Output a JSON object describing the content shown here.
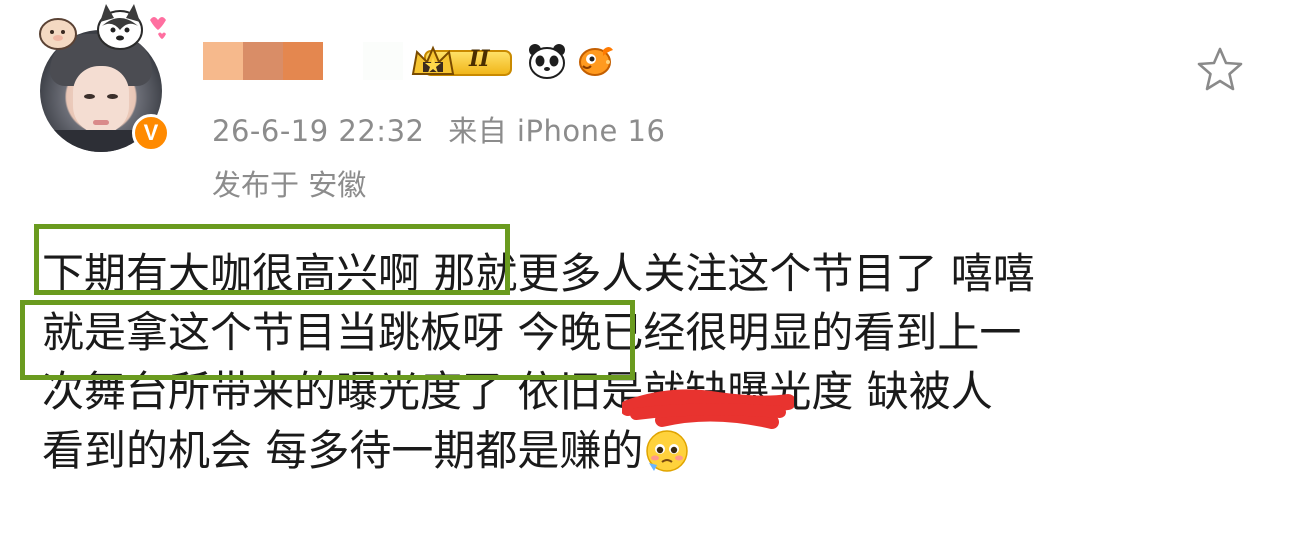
{
  "header": {
    "timestamp": "26-6-19 22:32",
    "source": "来自 iPhone 16",
    "location": "发布于 安徽",
    "level_badge_text": "II",
    "verified_badge": "V"
  },
  "post": {
    "lines": [
      "下期有大咖很高兴啊  那就更多人关注这个节目了 嘻嘻",
      "就是拿这个节目当跳板呀  今晚已经很明显的看到上一",
      "次舞台所带来的曝光度了  依旧是就缺曝光度  缺被人",
      "看到的机会  每多待一期都是赚的"
    ]
  },
  "icons": {
    "favorite": "star-outline-icon",
    "crown": "crown-icon",
    "panda": "panda-emoji-icon",
    "fish": "fish-emoji-icon",
    "pleading": "pleading-face-emoji-icon"
  },
  "colors": {
    "highlight_border": "#6a9b1f",
    "meta_text": "#8c8c8c",
    "verified": "#ff8a00",
    "redaction": "#e8332f"
  }
}
